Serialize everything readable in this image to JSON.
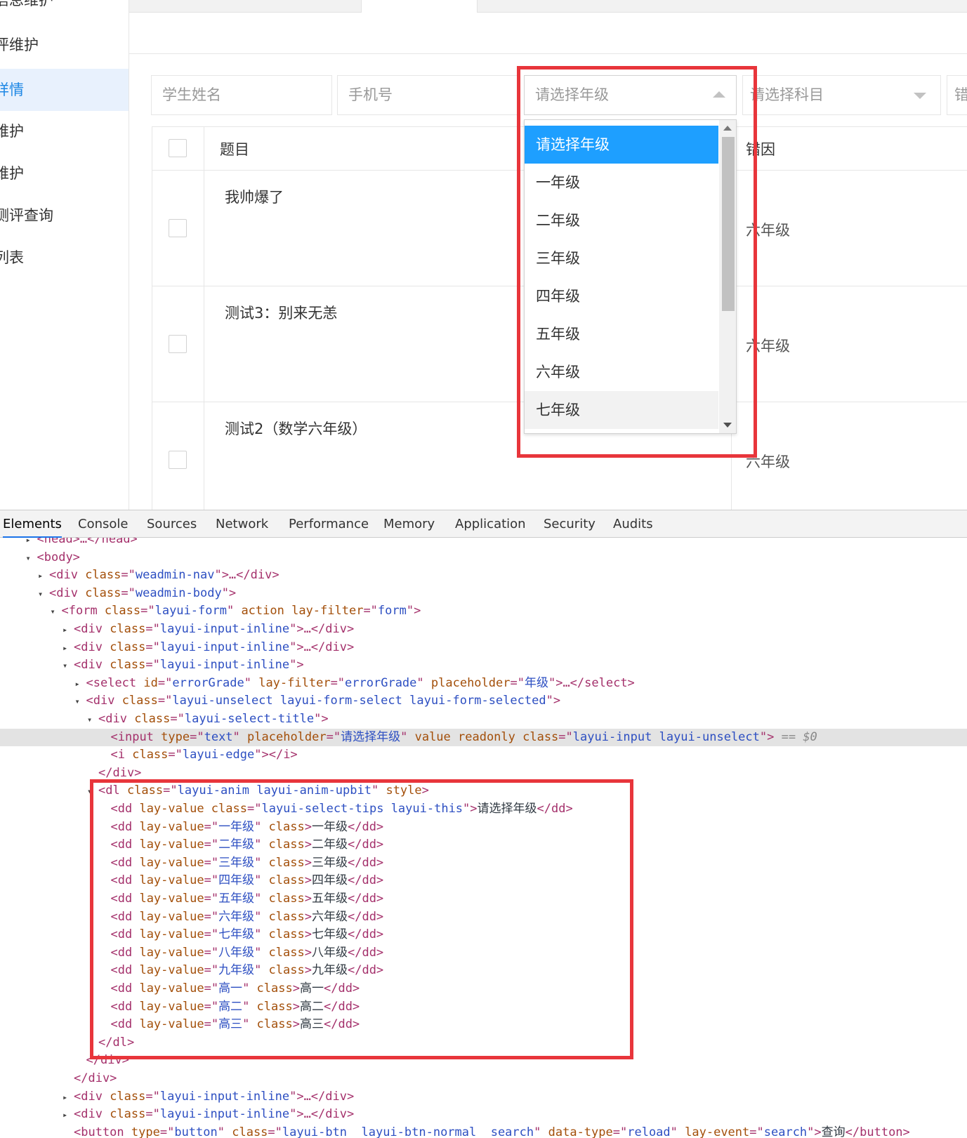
{
  "sidebar": {
    "items": [
      {
        "label": "信息维护",
        "active": false
      },
      {
        "label": "评维护",
        "active": false
      },
      {
        "label": "详情",
        "active": true
      },
      {
        "label": "维护",
        "active": false
      },
      {
        "label": "维护",
        "active": false
      },
      {
        "label": "测评查询",
        "active": false
      },
      {
        "label": "列表",
        "active": false
      }
    ]
  },
  "filters": {
    "student_name_placeholder": "学生姓名",
    "phone_placeholder": "手机号",
    "grade_placeholder": "请选择年级",
    "subject_placeholder": "请选择科目",
    "error_placeholder_partial": "错"
  },
  "table": {
    "headers": {
      "title": "题目",
      "reason": "错因"
    },
    "rows": [
      {
        "title": "我帅爆了",
        "grade": "六年级"
      },
      {
        "title": "测试3：别来无恙",
        "grade": "六年级"
      },
      {
        "title": "测试2（数学六年级）",
        "grade": "六年级"
      }
    ]
  },
  "dropdown": {
    "options": [
      "请选择年级",
      "一年级",
      "二年级",
      "三年级",
      "四年级",
      "五年级",
      "六年级",
      "七年级"
    ],
    "selected_index": 0,
    "hover_index": 7
  },
  "devtools": {
    "tabs": [
      "Elements",
      "Console",
      "Sources",
      "Network",
      "Performance",
      "Memory",
      "Application",
      "Security",
      "Audits"
    ],
    "active_tab": "Elements",
    "code_lines": [
      {
        "indent": 3,
        "arrow": "▸",
        "html": "&lt;head&gt;…&lt;/head&gt;"
      },
      {
        "indent": 3,
        "arrow": "▾",
        "html": "&lt;body&gt;"
      },
      {
        "indent": 4,
        "arrow": "▸",
        "html": "&lt;div <span class='attr'>class</span>=\"<span class='val'>weadmin-nav</span>\"&gt;…&lt;/div&gt;"
      },
      {
        "indent": 4,
        "arrow": "▾",
        "html": "&lt;div <span class='attr'>class</span>=\"<span class='val'>weadmin-body</span>\"&gt;"
      },
      {
        "indent": 5,
        "arrow": "▾",
        "html": "&lt;form <span class='attr'>class</span>=\"<span class='val'>layui-form</span>\" <span class='attr'>action lay-filter</span>=\"<span class='val'>form</span>\"&gt;"
      },
      {
        "indent": 6,
        "arrow": "▸",
        "html": "&lt;div <span class='attr'>class</span>=\"<span class='val'>layui-input-inline</span>\"&gt;…&lt;/div&gt;"
      },
      {
        "indent": 6,
        "arrow": "▸",
        "html": "&lt;div <span class='attr'>class</span>=\"<span class='val'>layui-input-inline</span>\"&gt;…&lt;/div&gt;"
      },
      {
        "indent": 6,
        "arrow": "▾",
        "html": "&lt;div <span class='attr'>class</span>=\"<span class='val'>layui-input-inline</span>\"&gt;"
      },
      {
        "indent": 7,
        "arrow": "▸",
        "html": "&lt;select <span class='attr'>id</span>=\"<span class='val'>errorGrade</span>\" <span class='attr'>lay-filter</span>=\"<span class='val'>errorGrade</span>\" <span class='attr'>placeholder</span>=\"<span class='val'>年级</span>\"&gt;…&lt;/select&gt;"
      },
      {
        "indent": 7,
        "arrow": "▾",
        "html": "&lt;div <span class='attr'>class</span>=\"<span class='val'>layui-unselect layui-form-select layui-form-selected</span>\"&gt;"
      },
      {
        "indent": 8,
        "arrow": "▾",
        "html": "&lt;div <span class='attr'>class</span>=\"<span class='val'>layui-select-title</span>\"&gt;"
      },
      {
        "indent": 9,
        "arrow": "",
        "hl": true,
        "html": "&lt;input <span class='attr'>type</span>=\"<span class='val'>text</span>\" <span class='attr'>placeholder</span>=\"<span class='val'>请选择年级</span>\" <span class='attr'>value readonly class</span>=\"<span class='val'>layui-input layui-unselect</span>\"&gt; <span class='muted'>== $0</span>"
      },
      {
        "indent": 9,
        "arrow": "",
        "html": "&lt;i <span class='attr'>class</span>=\"<span class='val'>layui-edge</span>\"&gt;&lt;/i&gt;"
      },
      {
        "indent": 8,
        "arrow": "",
        "html": "&lt;/div&gt;"
      },
      {
        "indent": 8,
        "arrow": "▾",
        "html": "&lt;dl <span class='attr'>class</span>=\"<span class='val'>layui-anim layui-anim-upbit</span>\" <span class='attr'>style</span>&gt;"
      },
      {
        "indent": 9,
        "arrow": "",
        "html": "&lt;dd <span class='attr'>lay-value class</span>=\"<span class='val'>layui-select-tips layui-this</span>\"&gt;<span class='txt'>请选择年级</span>&lt;/dd&gt;"
      },
      {
        "indent": 9,
        "arrow": "",
        "html": "&lt;dd <span class='attr'>lay-value</span>=\"<span class='val'>一年级</span>\" <span class='attr'>class</span>&gt;<span class='txt'>一年级</span>&lt;/dd&gt;"
      },
      {
        "indent": 9,
        "arrow": "",
        "html": "&lt;dd <span class='attr'>lay-value</span>=\"<span class='val'>二年级</span>\" <span class='attr'>class</span>&gt;<span class='txt'>二年级</span>&lt;/dd&gt;"
      },
      {
        "indent": 9,
        "arrow": "",
        "html": "&lt;dd <span class='attr'>lay-value</span>=\"<span class='val'>三年级</span>\" <span class='attr'>class</span>&gt;<span class='txt'>三年级</span>&lt;/dd&gt;"
      },
      {
        "indent": 9,
        "arrow": "",
        "html": "&lt;dd <span class='attr'>lay-value</span>=\"<span class='val'>四年级</span>\" <span class='attr'>class</span>&gt;<span class='txt'>四年级</span>&lt;/dd&gt;"
      },
      {
        "indent": 9,
        "arrow": "",
        "html": "&lt;dd <span class='attr'>lay-value</span>=\"<span class='val'>五年级</span>\" <span class='attr'>class</span>&gt;<span class='txt'>五年级</span>&lt;/dd&gt;"
      },
      {
        "indent": 9,
        "arrow": "",
        "html": "&lt;dd <span class='attr'>lay-value</span>=\"<span class='val'>六年级</span>\" <span class='attr'>class</span>&gt;<span class='txt'>六年级</span>&lt;/dd&gt;"
      },
      {
        "indent": 9,
        "arrow": "",
        "html": "&lt;dd <span class='attr'>lay-value</span>=\"<span class='val'>七年级</span>\" <span class='attr'>class</span>&gt;<span class='txt'>七年级</span>&lt;/dd&gt;"
      },
      {
        "indent": 9,
        "arrow": "",
        "html": "&lt;dd <span class='attr'>lay-value</span>=\"<span class='val'>八年级</span>\" <span class='attr'>class</span>&gt;<span class='txt'>八年级</span>&lt;/dd&gt;"
      },
      {
        "indent": 9,
        "arrow": "",
        "html": "&lt;dd <span class='attr'>lay-value</span>=\"<span class='val'>九年级</span>\" <span class='attr'>class</span>&gt;<span class='txt'>九年级</span>&lt;/dd&gt;"
      },
      {
        "indent": 9,
        "arrow": "",
        "html": "&lt;dd <span class='attr'>lay-value</span>=\"<span class='val'>高一</span>\" <span class='attr'>class</span>&gt;<span class='txt'>高一</span>&lt;/dd&gt;"
      },
      {
        "indent": 9,
        "arrow": "",
        "html": "&lt;dd <span class='attr'>lay-value</span>=\"<span class='val'>高二</span>\" <span class='attr'>class</span>&gt;<span class='txt'>高二</span>&lt;/dd&gt;"
      },
      {
        "indent": 9,
        "arrow": "",
        "html": "&lt;dd <span class='attr'>lay-value</span>=\"<span class='val'>高三</span>\" <span class='attr'>class</span>&gt;<span class='txt'>高三</span>&lt;/dd&gt;"
      },
      {
        "indent": 8,
        "arrow": "",
        "html": "&lt;/dl&gt;"
      },
      {
        "indent": 7,
        "arrow": "",
        "html": "&lt;/div&gt;"
      },
      {
        "indent": 6,
        "arrow": "",
        "html": "&lt;/div&gt;"
      },
      {
        "indent": 6,
        "arrow": "▸",
        "html": "&lt;div <span class='attr'>class</span>=\"<span class='val'>layui-input-inline</span>\"&gt;…&lt;/div&gt;"
      },
      {
        "indent": 6,
        "arrow": "▸",
        "html": "&lt;div <span class='attr'>class</span>=\"<span class='val'>layui-input-inline</span>\"&gt;…&lt;/div&gt;"
      },
      {
        "indent": 6,
        "arrow": "",
        "html": "&lt;button <span class='attr'>type</span>=\"<span class='val'>button</span>\" <span class='attr'>class</span>=\"<span class='val'>layui-btn  layui-btn-normal  search</span>\" <span class='attr'>data-type</span>=\"<span class='val'>reload</span>\" <span class='attr'>lay-event</span>=\"<span class='val'>search</span>\"&gt;<span class='txt'>查询</span>&lt;/button&gt;"
      }
    ]
  },
  "colors": {
    "accent": "#1e9fff",
    "active_sidebar_text": "#1e88e5",
    "highlight_box": "#e8353b"
  }
}
